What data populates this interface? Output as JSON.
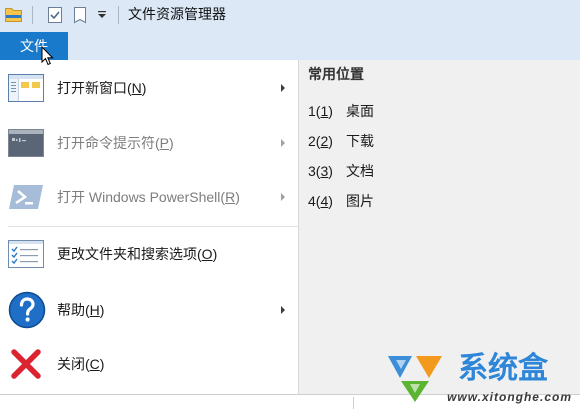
{
  "window": {
    "title": "文件资源管理器"
  },
  "quick_access_icons": [
    "file-explorer-icon",
    "properties-icon",
    "new-folder-icon",
    "customize-dropdown-icon"
  ],
  "ribbon": {
    "file_tab": "文件"
  },
  "file_menu": {
    "items": [
      {
        "icon": "new-window-icon",
        "before": "打开新窗口(",
        "key": "N",
        "after": ")",
        "has_submenu": true,
        "enabled": true
      },
      {
        "icon": "command-prompt-icon",
        "before": "打开命令提示符(",
        "key": "P",
        "after": ")",
        "has_submenu": true,
        "enabled": false
      },
      {
        "icon": "powershell-icon",
        "before": "打开 Windows PowerShell(",
        "key": "R",
        "after": ")",
        "has_submenu": true,
        "enabled": false
      },
      {
        "icon": "folder-options-icon",
        "before": "更改文件夹和搜索选项(",
        "key": "O",
        "after": ")",
        "has_submenu": false,
        "enabled": true
      },
      {
        "icon": "help-icon",
        "before": "帮助(",
        "key": "H",
        "after": ")",
        "has_submenu": true,
        "enabled": true
      },
      {
        "icon": "close-icon",
        "before": "关闭(",
        "key": "C",
        "after": ")",
        "has_submenu": false,
        "enabled": true
      }
    ]
  },
  "frequent_places": {
    "header": "常用位置",
    "items": [
      {
        "before": "1(",
        "key": "1",
        "after": ")",
        "name": "桌面"
      },
      {
        "before": "2(",
        "key": "2",
        "after": ")",
        "name": "下载"
      },
      {
        "before": "3(",
        "key": "3",
        "after": ")",
        "name": "文档"
      },
      {
        "before": "4(",
        "key": "4",
        "after": ")",
        "name": "图片"
      }
    ]
  },
  "watermark": {
    "brand": "系统盒",
    "url": "www.xitonghe.com"
  },
  "colors": {
    "file_tab": "#1979ca",
    "title_bar": "#dce8f5",
    "help": "#1f6fc6",
    "close": "#dc2430",
    "watermark": "#2e86d9"
  }
}
